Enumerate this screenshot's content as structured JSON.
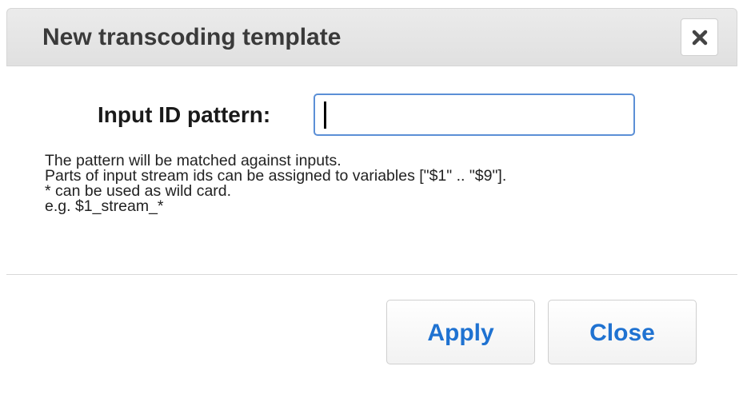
{
  "dialog": {
    "title": "New transcoding template",
    "close_icon": "close-x-icon"
  },
  "form": {
    "label": "Input ID pattern:",
    "value": "",
    "placeholder": ""
  },
  "help": {
    "lines": [
      "The pattern will be matched against inputs.",
      "Parts of input stream ids can be assigned to variables [\"$1\" .. \"$9\"].",
      "* can be used as wild card.",
      "e.g. $1_stream_*"
    ]
  },
  "buttons": {
    "apply_label": "Apply",
    "close_label": "Close"
  },
  "colors": {
    "accent": "#1f72d1",
    "input_border": "#5b8fd6"
  }
}
